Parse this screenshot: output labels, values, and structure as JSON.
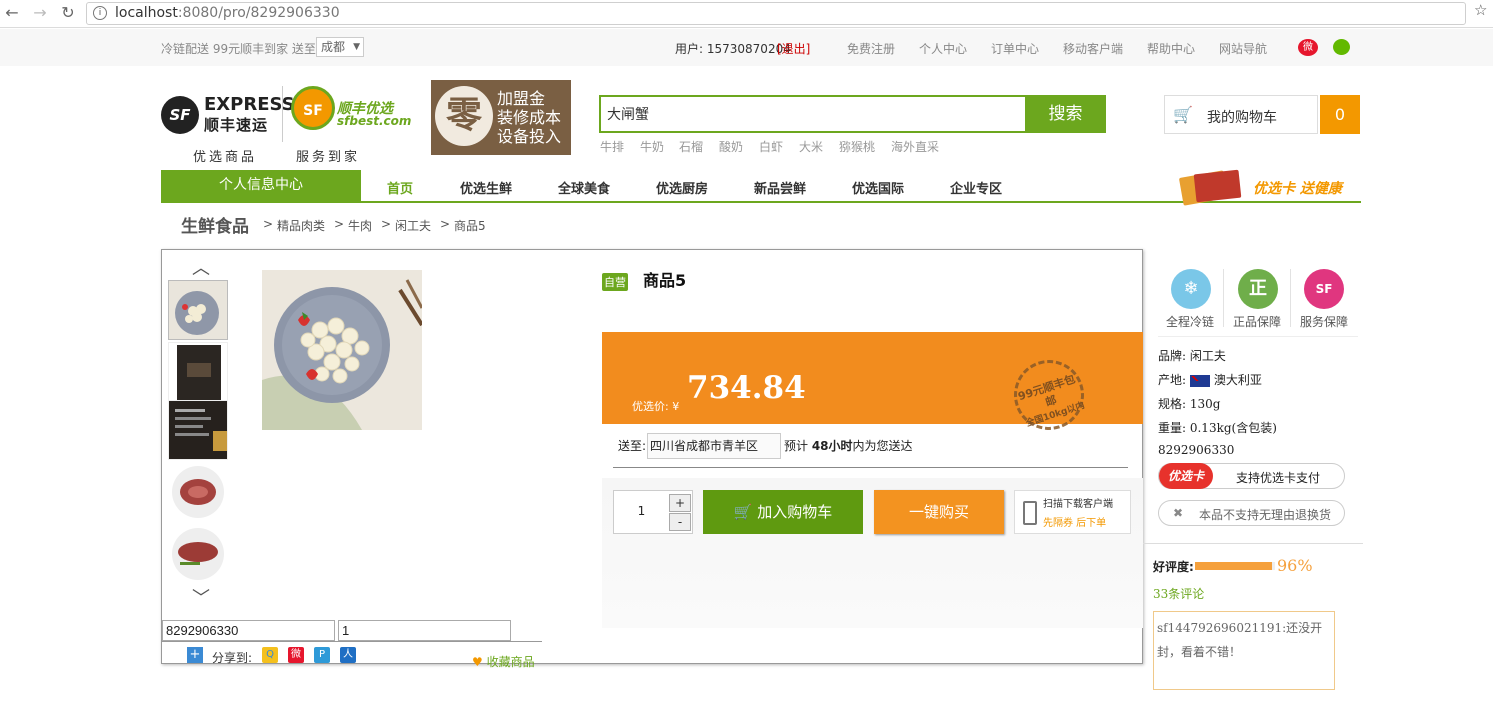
{
  "browser": {
    "url_host": "localhost",
    "url_path": ":8080/pro/8292906330"
  },
  "topbar": {
    "shipping_note": "冷链配送 99元顺丰到家 送至:",
    "city": "成都",
    "user_prefix": "用户: ",
    "user_id": "15730870204",
    "logout": "[退出]",
    "links": [
      "免费注册",
      "个人中心",
      "订单中心",
      "移动客户端",
      "帮助中心",
      "网站导航"
    ]
  },
  "header": {
    "logo_sf_letters": "SF",
    "logo_express": "EXPRESS",
    "logo_express_cn": "顺丰速运",
    "logo_sfbest_cn": "顺丰优选",
    "logo_sfbest_url": "sfbest.com",
    "slogan_left": "优选商品",
    "slogan_right": "服务到家",
    "promo_char": "零",
    "promo_lines": [
      "加盟金",
      "装修成本",
      "设备投入"
    ]
  },
  "search": {
    "value": "大闸蟹",
    "button": "搜索",
    "hot_words": [
      "牛排",
      "牛奶",
      "石榴",
      "酸奶",
      "白虾",
      "大米",
      "猕猴桃",
      "海外直采"
    ]
  },
  "cart": {
    "label": "我的购物车",
    "count": "0"
  },
  "nav": {
    "personal": "个人信息中心",
    "items": [
      "首页",
      "优选生鲜",
      "全球美食",
      "优选厨房",
      "新品尝鲜",
      "优选国际",
      "企业专区"
    ],
    "active_index": 0,
    "card_promo": "优选卡 送健康"
  },
  "breadcrumb": {
    "main": "生鲜食品",
    "items": [
      "精品肉类",
      "牛肉",
      "闲工夫",
      "商品5"
    ],
    "separator": ">"
  },
  "product": {
    "self_badge": "自营",
    "title": "商品5",
    "price_label": "优选价: ¥",
    "price": "734.84",
    "stamp_line1": "99元顺丰包邮",
    "stamp_line2": "全国10kg以内",
    "ship_label": "送至:",
    "ship_region": "四川省成都市青羊区",
    "ship_est_prefix": "预计 ",
    "ship_est_bold": "48小时",
    "ship_est_suffix": "内为您送达",
    "quantity": "1",
    "qty_plus": "+",
    "qty_minus": "-",
    "add_to_cart": "加入购物车",
    "buy_now": "一键购买",
    "app_line1": "扫描下载客户端",
    "app_line2": "先隔券 后下单",
    "id_field": "8292906330",
    "qty_field": "1",
    "share_label": "分享到:",
    "favorite": "收藏商品"
  },
  "services": [
    {
      "label": "全程冷链",
      "color": "#7ac7e8",
      "icon": "snowflake-icon"
    },
    {
      "label": "正品保障",
      "color": "#6fae4a",
      "icon": "genuine-icon",
      "glyph": "正"
    },
    {
      "label": "服务保障",
      "color": "#e0367f",
      "icon": "sf-service-icon",
      "glyph": "SF"
    }
  ],
  "attributes": {
    "brand": "品牌: 闲工夫",
    "origin_label": "产地: ",
    "origin": "澳大利亚",
    "spec": "规格: 130g",
    "weight": "重量: 0.13kg(含包装)",
    "sku": "8292906330"
  },
  "card_pay": {
    "tag": "优选卡",
    "text": "支持优选卡支付"
  },
  "no_return": "本品不支持无理由退换货",
  "rating": {
    "label": "好评度:",
    "value": "96%",
    "fraction": 0.96,
    "reviews": "33条评论",
    "sample_review": "sf144792696021191:还没开封，看着不错！"
  }
}
